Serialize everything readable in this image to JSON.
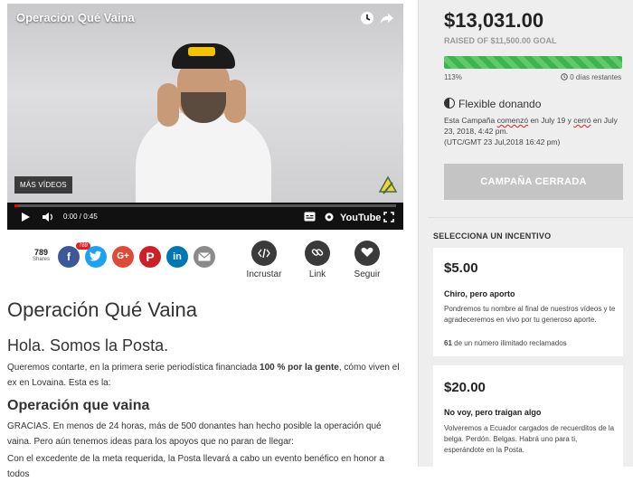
{
  "video": {
    "title": "Operación Qué Vaina",
    "more_videos": "MÁS VÍDEOS",
    "time": "0:00 / 0:45",
    "youtube": "YouTube",
    "progress": 0.01
  },
  "share": {
    "count": "789",
    "count_label": "Shares",
    "fb_badge": "789",
    "embed_label": "Incrustar",
    "link_label": "Link",
    "follow_label": "Seguir"
  },
  "article": {
    "title": "Operación Qué Vaina",
    "subtitle": "Hola. Somos la Posta.",
    "intro_a": "Queremos contarte, en la primera serie periodística financiada ",
    "intro_bold": "100 % por la gente",
    "intro_b": ", cómo viven el ex en Lovaina. Esta es la:",
    "section_title": "Operación que vaina",
    "para1": "GRACIAS. En menos de 24 horas, más de 500 donantes han hecho posible la operación qué vaina. Pero aún tenemos ideas para los apoyos que no paran de llegar:",
    "para2": "Con el excedente de la meta requerida, la Posta llevará a cabo un evento benéfico en honor a todos"
  },
  "campaign": {
    "amount": "$13,031.00",
    "raised": "RAISED OF $11,500.00 GOAL",
    "percent_label": "113%",
    "percent": 1.0,
    "remaining": "0 días restantes",
    "flexible": "Flexible donando",
    "text_a": "Esta Campaña ",
    "text_u1": "comenzó",
    "text_b": " en July 19 y ",
    "text_u2": "cerró",
    "text_c": " en July 23, 2018, 4:42 pm.",
    "text_d": "(UTC/GMT 23 Jul,2018 16:42 pm)",
    "closed_button": "CAMPAÑA CERRADA",
    "incentive_title": "SELECCIONA UN INCENTIVO"
  },
  "incentives": [
    {
      "amount": "$5.00",
      "name": "Chiro, pero aporto",
      "desc": "Pondremos tu nombre al final de nuestros vídeos y te agradeceremos en vivo por tu generoso aporte.",
      "claimed_num": "61",
      "claimed_text": " de un número ilimitado reclamados"
    },
    {
      "amount": "$20.00",
      "name": "No voy, pero traigan algo",
      "desc": "Volveremos a Ecuador cargados de recuerditos de la belga. Perdón. Belgas. Habrá uno para ti, esperándote en la Posta."
    }
  ],
  "colors": {
    "progress_green": "#3fb34f",
    "facebook": "#3b5998",
    "twitter": "#1da1f2",
    "google": "#dd4b39",
    "pinterest": "#cb2027",
    "linkedin": "#0077b5",
    "email": "#8a8a8a",
    "annotation_arrow": "#e02020"
  },
  "icons": [
    "clock-icon",
    "share-icon",
    "play-icon",
    "volume-icon",
    "captions-icon",
    "settings-icon",
    "fullscreen-icon",
    "facebook-icon",
    "twitter-icon",
    "google-plus-icon",
    "pinterest-icon",
    "linkedin-icon",
    "email-icon",
    "embed-icon",
    "link-icon",
    "heart-icon",
    "flexible-icon"
  ]
}
